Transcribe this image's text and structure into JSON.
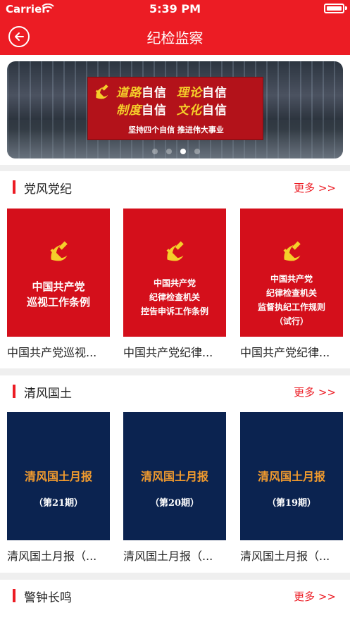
{
  "status_bar": {
    "carrier": "Carrier",
    "time": "5:39 PM"
  },
  "nav": {
    "title": "纪检监察"
  },
  "banner": {
    "line1_a": "道路",
    "line1_b": "自信",
    "line1_c": "理论",
    "line1_d": "自信",
    "line2_a": "制度",
    "line2_b": "自信",
    "line2_c": "文化",
    "line2_d": "自信",
    "subtitle": "坚持四个自信 推进伟大事业",
    "pager": {
      "count": 4,
      "active_index": 2
    }
  },
  "sections": [
    {
      "title": "党风党纪",
      "more": "更多 >>",
      "items": [
        {
          "cover_lines": [
            "中国共产党",
            "巡视工作条例"
          ],
          "caption": "中国共产党巡视..."
        },
        {
          "cover_lines": [
            "中国共产党",
            "纪律检查机关",
            "控告申诉工作条例"
          ],
          "caption": "中国共产党纪律..."
        },
        {
          "cover_lines": [
            "中国共产党",
            "纪律检查机关",
            "监督执纪工作规则",
            "（试行）"
          ],
          "caption": "中国共产党纪律..."
        }
      ]
    },
    {
      "title": "清风国土",
      "more": "更多 >>",
      "items": [
        {
          "cover_title": "清风国土月报",
          "cover_issue": "（第21期）",
          "caption": "清风国土月报（..."
        },
        {
          "cover_title": "清风国土月报",
          "cover_issue": "（第20期）",
          "caption": "清风国土月报（..."
        },
        {
          "cover_title": "清风国土月报",
          "cover_issue": "（第19期）",
          "caption": "清风国土月报（..."
        }
      ]
    },
    {
      "title": "警钟长鸣",
      "more": "更多 >>"
    }
  ],
  "colors": {
    "brand_red": "#ec1c24",
    "cover_red": "#d40f1b",
    "cover_navy": "#0b2350",
    "issue_orange": "#f09a2e"
  },
  "icons": {
    "back": "back-arrow-circle-icon",
    "emblem": "party-emblem-icon"
  }
}
